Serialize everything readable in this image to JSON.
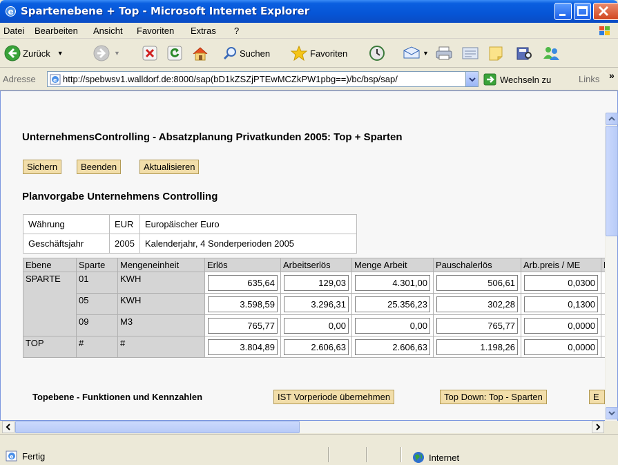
{
  "window": {
    "title": "Spartenebene + Top - Microsoft Internet Explorer"
  },
  "menu": {
    "items": [
      "Datei",
      "Bearbeiten",
      "Ansicht",
      "Favoriten",
      "Extras",
      "?"
    ]
  },
  "toolbar": {
    "back": "Zurück",
    "search": "Suchen",
    "favorites": "Favoriten"
  },
  "address": {
    "label": "Adresse",
    "url": "http://spebwsv1.walldorf.de:8000/sap(bD1kZSZjPTEwMCZkPW1pbg==)/bc/bsp/sap/",
    "go": "Wechseln zu",
    "links": "Links"
  },
  "page": {
    "title": "UnternehmensControlling - Absatzplanung Privatkunden 2005: Top + Sparten",
    "buttons": [
      "Sichern",
      "Beenden",
      "Aktualisieren"
    ],
    "section_title": "Planvorgabe Unternehmens Controlling",
    "info": {
      "currency_label": "Währung",
      "currency_code": "EUR",
      "currency_name": "Europäischer Euro",
      "year_label": "Geschäftsjahr",
      "year": "2005",
      "year_desc": "Kalenderjahr, 4 Sonderperioden 2005"
    },
    "table": {
      "headers": [
        "Ebene",
        "Sparte",
        "Mengeneinheit",
        "Erlös",
        "Arbeitserlös",
        "Menge Arbeit",
        "Pauschalerlös",
        "Arb.preis / ME",
        "F"
      ],
      "rows": [
        {
          "ebene": "SPARTE",
          "sparte": "01",
          "unit": "KWH",
          "erloes": "635,64",
          "arbeitserloes": "129,03",
          "menge": "4.301,00",
          "pauschal": "506,61",
          "preis": "0,0300"
        },
        {
          "ebene": "",
          "sparte": "05",
          "unit": "KWH",
          "erloes": "3.598,59",
          "arbeitserloes": "3.296,31",
          "menge": "25.356,23",
          "pauschal": "302,28",
          "preis": "0,1300"
        },
        {
          "ebene": "",
          "sparte": "09",
          "unit": "M3",
          "erloes": "765,77",
          "arbeitserloes": "0,00",
          "menge": "0,00",
          "pauschal": "765,77",
          "preis": "0,0000"
        },
        {
          "ebene": "TOP",
          "sparte": "#",
          "unit": "#",
          "erloes": "3.804,89",
          "arbeitserloes": "2.606,63",
          "menge": "2.606,63",
          "pauschal": "1.198,26",
          "preis": "0,0000"
        }
      ]
    },
    "bottom": {
      "label": "Topebene - Funktionen und Kennzahlen",
      "buttons": [
        "IST Vorperiode übernehmen",
        "Top Down: Top - Sparten",
        "E"
      ]
    }
  },
  "status": {
    "text": "Fertig",
    "zone": "Internet"
  }
}
